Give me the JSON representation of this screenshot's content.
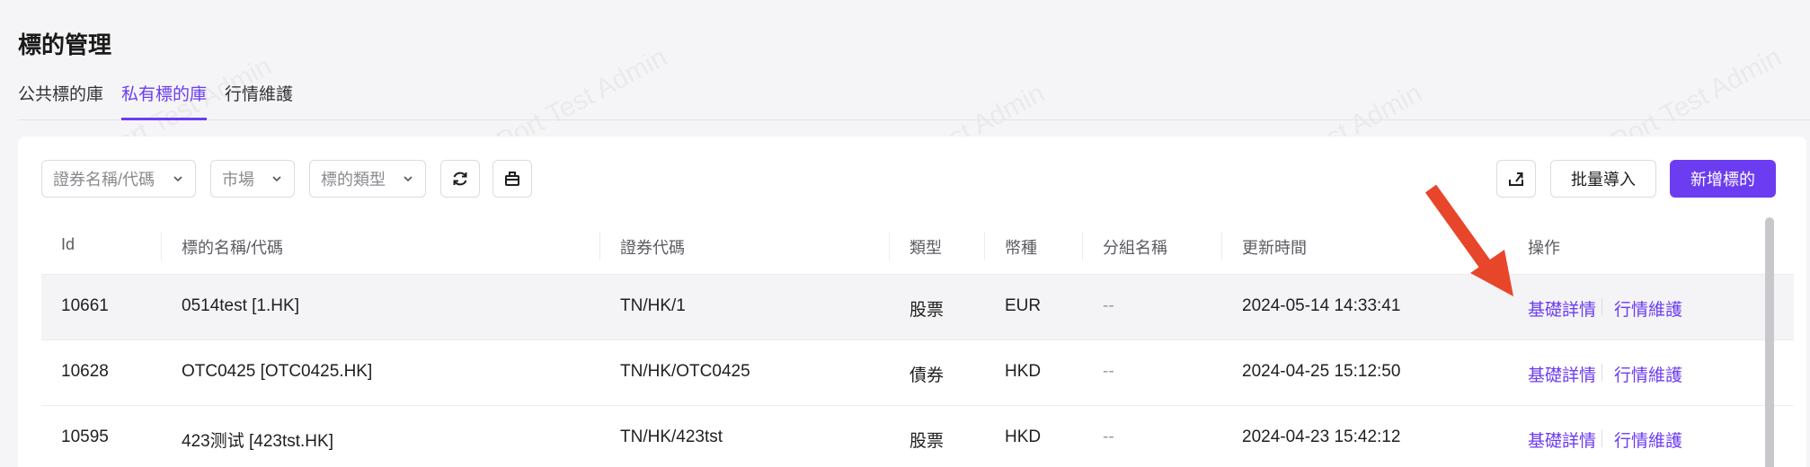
{
  "page": {
    "title": "標的管理"
  },
  "tabs": [
    {
      "label": "公共標的庫",
      "active": false
    },
    {
      "label": "私有標的庫",
      "active": true
    },
    {
      "label": "行情維護",
      "active": false
    }
  ],
  "toolbar": {
    "filters": [
      {
        "placeholder": "證券名稱/代碼"
      },
      {
        "placeholder": "市場"
      },
      {
        "placeholder": "標的類型"
      }
    ],
    "refresh_icon": "refresh-icon",
    "clear_icon": "clear-filter-icon",
    "export_icon": "export-icon",
    "import_label": "批量導入",
    "add_label": "新增標的"
  },
  "table": {
    "headers": [
      "Id",
      "標的名稱/代碼",
      "證券代碼",
      "類型",
      "幣種",
      "分組名稱",
      "更新時間",
      "操作"
    ],
    "rows": [
      {
        "id": "10661",
        "name": "0514test [1.HK]",
        "code": "TN/HK/1",
        "type": "股票",
        "currency": "EUR",
        "group": "--",
        "updated": "2024-05-14 14:33:41",
        "op1": "基礎詳情",
        "op2": "行情維護"
      },
      {
        "id": "10628",
        "name": "OTC0425 [OTC0425.HK]",
        "code": "TN/HK/OTC0425",
        "type": "債券",
        "currency": "HKD",
        "group": "--",
        "updated": "2024-04-25 15:12:50",
        "op1": "基礎詳情",
        "op2": "行情維護"
      },
      {
        "id": "10595",
        "name": "423测试 [423tst.HK]",
        "code": "TN/HK/423tst",
        "type": "股票",
        "currency": "HKD",
        "group": "--",
        "updated": "2024-04-23 15:42:12",
        "op1": "基礎詳情",
        "op2": "行情維護"
      }
    ]
  },
  "colors": {
    "accent": "#6c3cf0",
    "arrow": "#e8462a"
  },
  "watermark": "LongPort Test Admin"
}
